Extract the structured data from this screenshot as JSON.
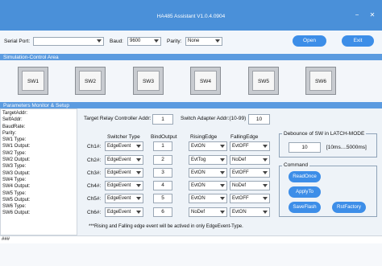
{
  "window": {
    "title": "HA485 Assistant V1.0.4.0904",
    "min_symbol": "−",
    "close_symbol": "✕"
  },
  "toolbar": {
    "serial_port_label": "Serial Port:",
    "serial_port_value": "",
    "baud_label": "Baud:",
    "baud_value": "9600",
    "parity_label": "Parity:",
    "parity_value": "None",
    "open_label": "Open",
    "exit_label": "Exit"
  },
  "simulation": {
    "header": "Simulation-Control Area",
    "switches": [
      "SW1",
      "SW2",
      "SW3",
      "SW4",
      "SW5",
      "SW6"
    ]
  },
  "monitor": {
    "header": "Parameters Monitor & Setup",
    "items": [
      "TargetAddr:",
      "SelfAddr:",
      "BaudRate:",
      "Parity:",
      "SW1 Type:",
      "SW1 Output:",
      "SW2 Type:",
      "SW2 Output:",
      "SW3 Type:",
      "SW3 Output:",
      "SW4 Type:",
      "SW4 Output:",
      "SW5 Type:",
      "SW5 Output:",
      "SW6 Type:",
      "SW6 Output:"
    ]
  },
  "setup": {
    "target_addr_label": "Target Relay Controller Addr:",
    "target_addr_value": "1",
    "adapter_addr_label": "Switch Adapter Addr:(10-99)",
    "adapter_addr_value": "10",
    "columns": [
      "Switcher Type",
      "BindOutput",
      "RisingEdge",
      "FallingEdge"
    ],
    "channels": [
      {
        "label": "Ch1#:",
        "type": "EdgeEvent",
        "output": "1",
        "rising": "EvtON",
        "falling": "EvtOFF"
      },
      {
        "label": "Ch2#:",
        "type": "EdgeEvent",
        "output": "2",
        "rising": "EvtTog",
        "falling": "NoDef"
      },
      {
        "label": "Ch3#:",
        "type": "EdgeEvent",
        "output": "3",
        "rising": "EvtON",
        "falling": "EvtOFF"
      },
      {
        "label": "Ch4#:",
        "type": "EdgeEvent",
        "output": "4",
        "rising": "EvtON",
        "falling": "NoDef"
      },
      {
        "label": "Ch5#:",
        "type": "EdgeEvent",
        "output": "5",
        "rising": "EvtON",
        "falling": "EvtOFF"
      },
      {
        "label": "Ch6#:",
        "type": "EdgeEvent",
        "output": "6",
        "rising": "NoDef",
        "falling": "EvtON"
      }
    ],
    "note": "***Rising and Falling edge event will be actived in only EdgeEvent-Type."
  },
  "debounce": {
    "title": "Debounce of SW in LATCH-MODE",
    "value": "10",
    "range": "[10ms....5000ms]"
  },
  "command": {
    "title": "Command",
    "read_once": "ReadOnce",
    "apply_to": "ApplyTo",
    "save_flash": "SaveFlash",
    "rst_factory": "RstFactory"
  },
  "status": {
    "text": "###"
  },
  "colors": {
    "titlebar": "#4a90d9",
    "accent": "#3d8ee8",
    "section": "#5b9be0"
  }
}
